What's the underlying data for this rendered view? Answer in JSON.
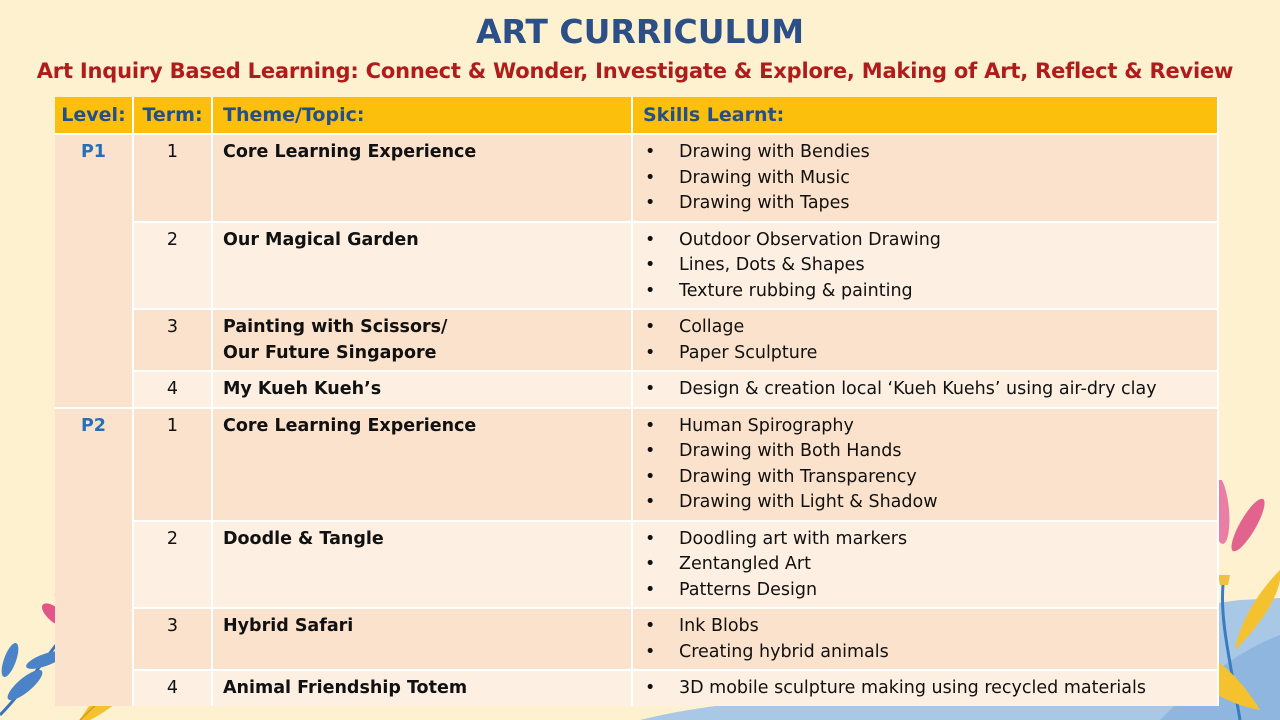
{
  "slide": {
    "title": "ART CURRICULUM",
    "subtitle": "Art Inquiry Based Learning: Connect & Wonder, Investigate & Explore, Making of Art, Reflect & Review"
  },
  "table": {
    "headers": {
      "level": "Level:",
      "term": "Term:",
      "theme": "Theme/Topic:",
      "skills": "Skills Learnt:"
    },
    "levels": {
      "p1": "P1",
      "p2": "P2"
    },
    "rows": [
      {
        "term": "1",
        "theme_lines": [
          "Core Learning Experience"
        ],
        "skills": [
          "Drawing with Bendies",
          "Drawing with Music",
          "Drawing with Tapes"
        ]
      },
      {
        "term": "2",
        "theme_lines": [
          "Our Magical Garden"
        ],
        "skills": [
          "Outdoor Observation Drawing",
          "Lines, Dots & Shapes",
          "Texture rubbing & painting"
        ]
      },
      {
        "term": "3",
        "theme_lines": [
          "Painting with Scissors/",
          "Our Future Singapore"
        ],
        "skills": [
          "Collage",
          "Paper Sculpture"
        ]
      },
      {
        "term": "4",
        "theme_lines": [
          "My Kueh Kueh’s"
        ],
        "skills": [
          "Design & creation local ‘Kueh Kuehs’ using air-dry clay"
        ]
      },
      {
        "term": "1",
        "theme_lines": [
          "Core Learning Experience"
        ],
        "skills": [
          "Human Spirography",
          "Drawing with Both Hands",
          "Drawing with Transparency",
          "Drawing with Light & Shadow"
        ]
      },
      {
        "term": "2",
        "theme_lines": [
          "Doodle  & Tangle"
        ],
        "skills": [
          "Doodling art with markers",
          "Zentangled Art",
          "Patterns Design"
        ]
      },
      {
        "term": "3",
        "theme_lines": [
          "Hybrid Safari"
        ],
        "skills": [
          "Ink Blobs",
          "Creating hybrid animals"
        ]
      },
      {
        "term": "4",
        "theme_lines": [
          "Animal Friendship Totem"
        ],
        "skills": [
          "3D mobile sculpture making using recycled materials"
        ]
      }
    ]
  },
  "colors": {
    "background": "#fdf1cf",
    "title": "#2b4f86",
    "subtitle": "#b01c1c",
    "header_fill": "#fcc00c",
    "header_text": "#23508a",
    "row_dark": "#fbe2cc",
    "row_light": "#fdefe2",
    "level_text": "#2570b5"
  },
  "decorations": [
    "flower-leaf-left-icon",
    "cartoon-girl-icon",
    "flower-leaf-right-icon"
  ]
}
